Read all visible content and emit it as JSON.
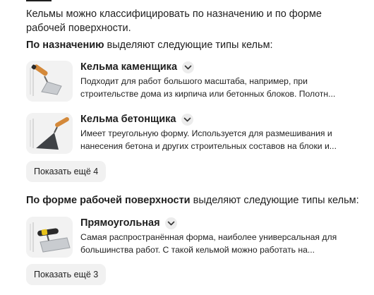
{
  "intro": {
    "text": "Кельмы можно классифицировать по назначению и по форме рабочей поверхности."
  },
  "sections": [
    {
      "heading_bold": "По назначению",
      "heading_rest": " выделяют следующие типы кельм:",
      "items": [
        {
          "title": "Кельма каменщика",
          "description": "Подходит для работ большого масштаба, например, при строительстве дома из кирпича или бетонных блоков. Полотн...",
          "icon": "chevron-down-icon"
        },
        {
          "title": "Кельма бетонщика",
          "description": "Имеет треугольную форму. Используется для размешивания и нанесения бетона и других строительных составов на блоки и...",
          "icon": "chevron-down-icon"
        }
      ],
      "more_label": "Показать ещё 4"
    },
    {
      "heading_bold": "По форме рабочей поверхности",
      "heading_rest": " выделяют следующие типы кельм:",
      "items": [
        {
          "title": "Прямоугольная",
          "description": "Самая распространённая форма, наиболее универсальная для большинства работ. С такой кельмой можно работать на...",
          "icon": "chevron-down-icon"
        }
      ],
      "more_label": "Показать ещё 3"
    }
  ],
  "colors": {
    "text": "#1f1f1f",
    "button_bg": "#f1f1f1",
    "thumb_bg": "#f2f2f2",
    "wood_handle": "#d4893a"
  }
}
